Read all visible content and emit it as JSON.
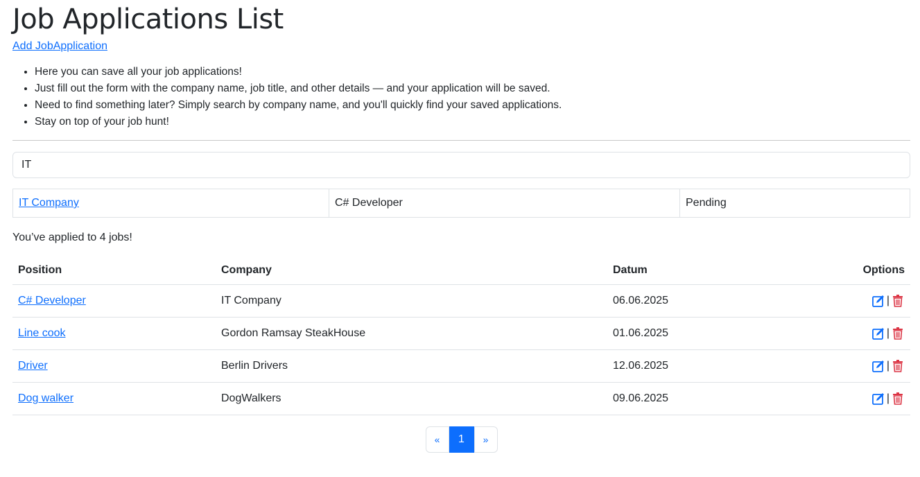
{
  "title": "Job Applications List",
  "add_link": "Add JobApplication",
  "info": [
    "Here you can save all your job applications!",
    "Just fill out the form with the company name, job title, and other details — and your application will be saved.",
    "Need to find something later? Simply search by company name, and you'll quickly find your saved applications.",
    "Stay on top of your job hunt!"
  ],
  "search": {
    "value": "IT"
  },
  "search_result": {
    "company": "IT Company",
    "position": "C# Developer",
    "status": "Pending"
  },
  "count_text": "You’ve applied to 4 jobs!",
  "table": {
    "headers": {
      "position": "Position",
      "company": "Company",
      "date": "Datum",
      "options": "Options"
    },
    "rows": [
      {
        "position": "C# Developer",
        "company": "IT Company",
        "date": "06.06.2025"
      },
      {
        "position": "Line cook",
        "company": "Gordon Ramsay SteakHouse",
        "date": "01.06.2025"
      },
      {
        "position": "Driver",
        "company": "Berlin Drivers",
        "date": "12.06.2025"
      },
      {
        "position": "Dog walker",
        "company": "DogWalkers",
        "date": "09.06.2025"
      }
    ]
  },
  "separator": "|",
  "pagination": {
    "prev": "«",
    "current": "1",
    "next": "»"
  }
}
